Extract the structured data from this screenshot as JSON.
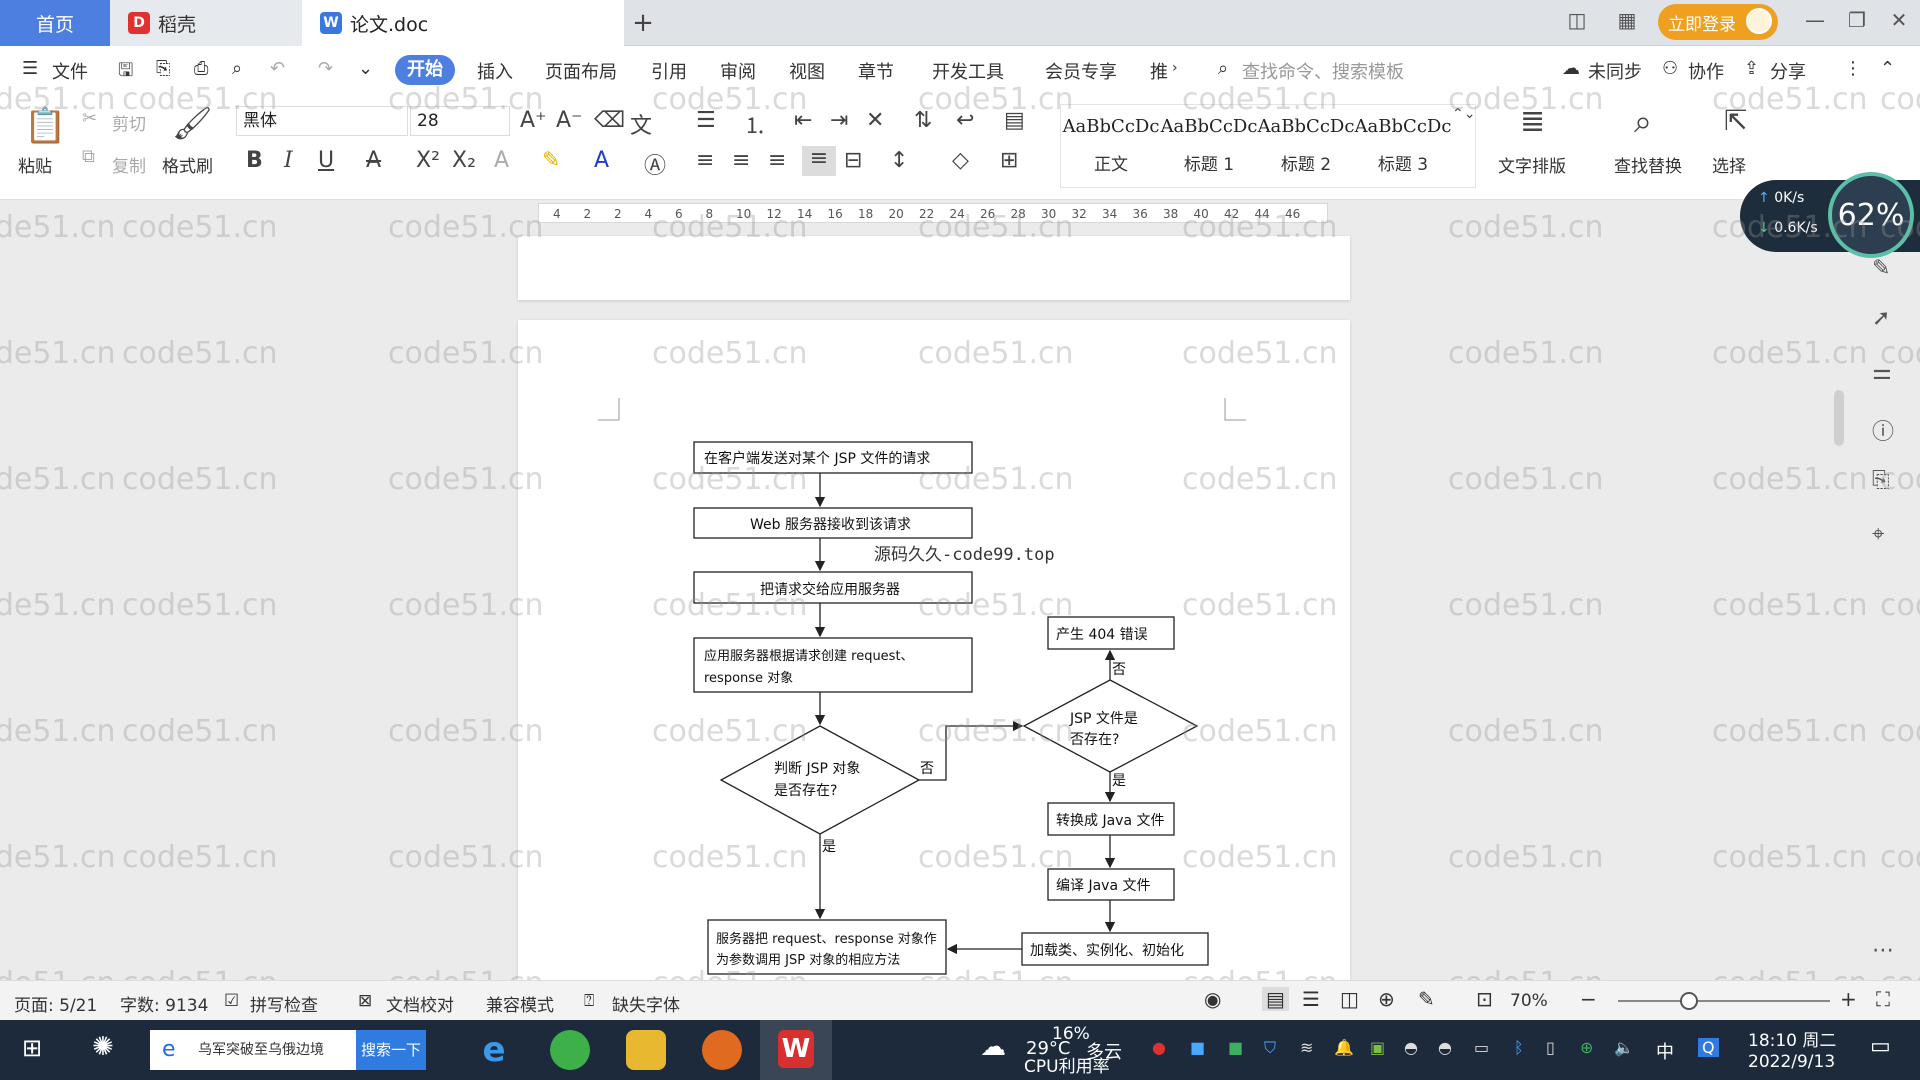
{
  "tabs": {
    "home": "首页",
    "daoke": "稻壳",
    "doc": "论文.doc",
    "add": "+"
  },
  "header": {
    "login": "立即登录"
  },
  "ribbon_tabs": {
    "file": "文件",
    "start": "开始",
    "insert": "插入",
    "layout": "页面布局",
    "reference": "引用",
    "review": "审阅",
    "view": "视图",
    "chapter": "章节",
    "dev": "开发工具",
    "member": "会员专享",
    "recommend": "推",
    "search_placeholder": "查找命令、搜索模板",
    "unsynced": "未同步",
    "collab": "协作",
    "share": "分享"
  },
  "ribbon": {
    "paste": "粘贴",
    "cut": "剪切",
    "copy": "复制",
    "format_painter": "格式刷",
    "font": "黑体",
    "size": "28",
    "styles": [
      {
        "preview": "AaBbCcDc",
        "label": "正文"
      },
      {
        "preview": "AaBbCcDc",
        "label": "标题 1"
      },
      {
        "preview": "AaBbCcDc",
        "label": "标题 2"
      },
      {
        "preview": "AaBbCcDc",
        "label": "标题 3"
      }
    ],
    "text_layout": "文字排版",
    "find_replace": "查找替换",
    "select": "选择"
  },
  "ruler": {
    "ticks": [
      "4",
      "2",
      "2",
      "4",
      "6",
      "8",
      "10",
      "12",
      "14",
      "16",
      "18",
      "20",
      "22",
      "24",
      "26",
      "28",
      "30",
      "32",
      "34",
      "36",
      "38",
      "40",
      "42",
      "44",
      "46"
    ]
  },
  "net": {
    "up": "0K/s",
    "down": "0.6K/s",
    "percent": "62%"
  },
  "flow": {
    "n1": "在客户端发送对某个 JSP 文件的请求",
    "n2": "Web 服务器接收到该请求",
    "n3": "把请求交给应用服务器",
    "n4a": "应用服务器根据请求创建 request、",
    "n4b": "response 对象",
    "d1a": "判断 JSP 对象",
    "d1b": "是否存在?",
    "d2a": "JSP 文件是",
    "d2b": "否存在?",
    "e404": "产生 404 错误",
    "convert": "转换成 Java 文件",
    "compile": "编译 Java 文件",
    "load": "加载类、实例化、初始化",
    "call_a": "服务器把 request、response 对象作",
    "call_b": "为参数调用 JSP 对象的相应方法",
    "no1": "否",
    "no2": "否",
    "yes1": "是",
    "yes2": "是",
    "overlay": "源码久久-code99.top"
  },
  "status": {
    "page": "页面: 5/21",
    "words": "字数: 9134",
    "spell": "拼写检查",
    "proof": "文档校对",
    "compat": "兼容模式",
    "missing_font": "缺失字体",
    "zoom": "70%"
  },
  "taskbar": {
    "search_text": "乌军突破至乌俄边境",
    "search_btn": "搜索一下",
    "weather_temp": "29°C",
    "weather_desc": "多云",
    "cpu_pct": "16%",
    "cpu_label": "CPU利用率",
    "ime": "中",
    "time": "18:10 周二",
    "date": "2022/9/13"
  },
  "watermark": "code51.cn",
  "colors": {
    "accent": "#4d7fe0",
    "login": "#f0a020",
    "taskbar": "#1c2a3c"
  }
}
